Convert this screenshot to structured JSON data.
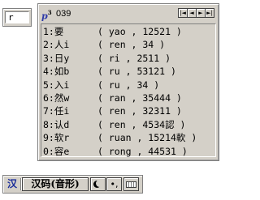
{
  "composition": {
    "text": "r"
  },
  "candidates": {
    "page_icon_glyph": "p",
    "page_icon_sup": "3",
    "page_count": "039",
    "nav_buttons": [
      "|◄",
      "◄",
      "►",
      "►|"
    ],
    "rows": [
      {
        "index": "1:",
        "word": "要",
        "code": "( yao , 12521 )"
      },
      {
        "index": "2:",
        "word": "人i",
        "code": "( ren , 34 )"
      },
      {
        "index": "3:",
        "word": "日y",
        "code": "( ri , 2511 )"
      },
      {
        "index": "4:",
        "word": "如b",
        "code": "( ru , 53121 )"
      },
      {
        "index": "5:",
        "word": "入i",
        "code": "( ru , 34 )"
      },
      {
        "index": "6:",
        "word": "然w",
        "code": "( ran , 35444 )"
      },
      {
        "index": "7:",
        "word": "任i",
        "code": "( ren , 32311 )"
      },
      {
        "index": "8:",
        "word": "认d",
        "code": "( ren , 4534認 )"
      },
      {
        "index": "9:",
        "word": "软r",
        "code": "( ruan , 15214軟 )"
      },
      {
        "index": "0:",
        "word": "容e",
        "code": "( rong , 44531 )"
      }
    ]
  },
  "status_bar": {
    "logo_glyph": "汉",
    "input_method_name": "汉码(音形)",
    "moon_button_icon": "half-width-moon-icon",
    "punct_button_label": "•,",
    "keyboard_button_icon": "soft-keyboard-icon"
  }
}
